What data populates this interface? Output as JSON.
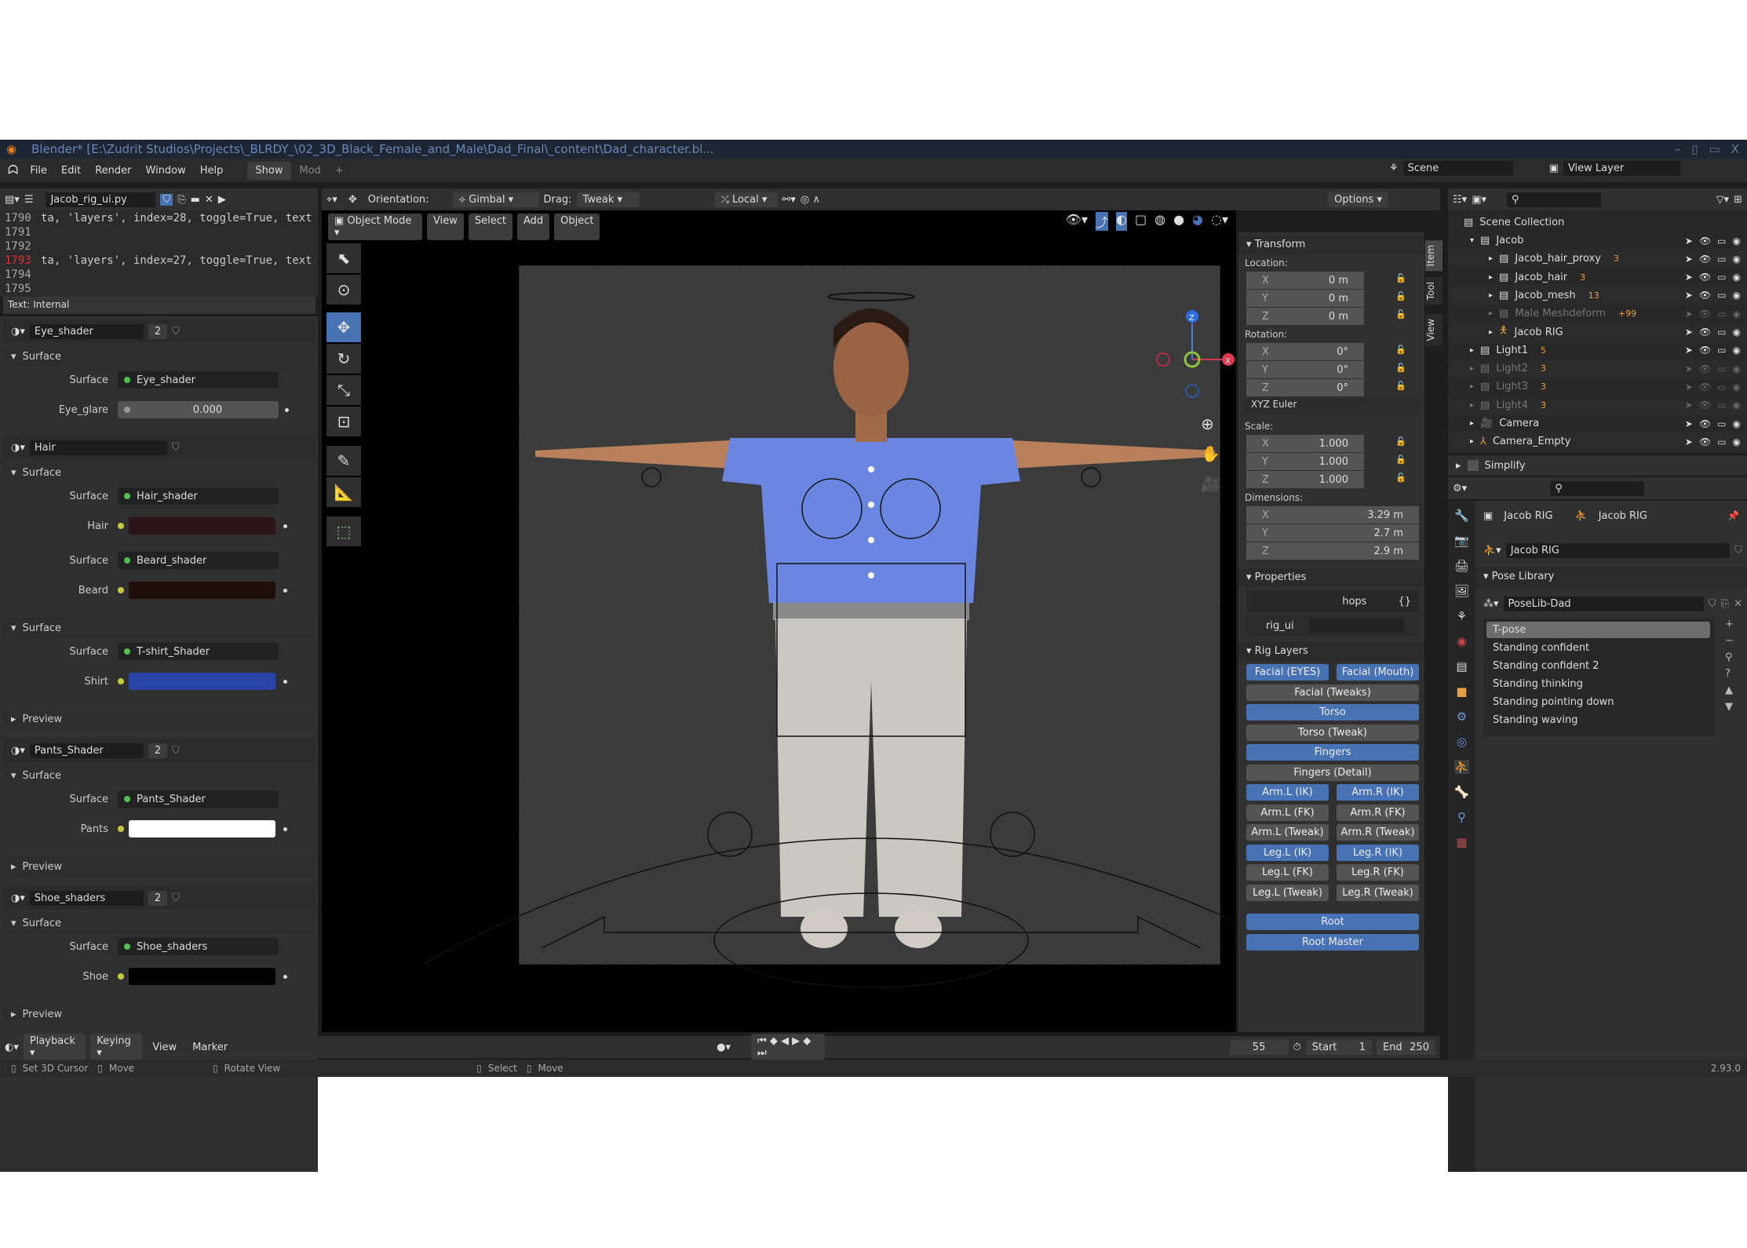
{
  "title_bar": {
    "text": "Blender* [E:\\Zudrit Studios\\Projects\\_BLRDY_\\02_3D_Black_Female_and_Male\\Dad_Final\\_content\\Dad_character.bl...",
    "controls": [
      "–",
      "▯",
      "▭",
      "X"
    ]
  },
  "menu": {
    "items": [
      "File",
      "Edit",
      "Render",
      "Window",
      "Help"
    ],
    "workspaces": [
      "Show",
      "Mod"
    ],
    "add": "+",
    "scene": "Scene",
    "view_layer": "View Layer"
  },
  "text_editor": {
    "filename": "Jacob_rig_ui.py",
    "lines": [
      {
        "n": "1790",
        "code": "ta, 'layers', index=28, toggle=True, text"
      },
      {
        "n": "1791",
        "code": ""
      },
      {
        "n": "1792",
        "code": ""
      },
      {
        "n": "1793",
        "code": "ta, 'layers', index=27, toggle=True, text"
      },
      {
        "n": "1794",
        "code": ""
      },
      {
        "n": "1795",
        "code": ""
      }
    ],
    "footer": "Text: Internal"
  },
  "materials": [
    {
      "name": "Eye_shader",
      "users": "2",
      "sections": [
        {
          "title": "Surface",
          "rows": [
            {
              "label": "Surface",
              "value": "Eye_shader",
              "type": "shader"
            },
            {
              "label": "Eye_glare",
              "value": "0.000",
              "type": "number"
            }
          ]
        }
      ]
    },
    {
      "name": "Hair",
      "users": "",
      "sections": [
        {
          "title": "Surface",
          "rows": [
            {
              "label": "Surface",
              "value": "Hair_shader",
              "type": "shader"
            },
            {
              "label": "Hair",
              "color": "#2a1618",
              "type": "color"
            },
            {
              "label": "Surface",
              "value": "Beard_shader",
              "type": "shader"
            },
            {
              "label": "Beard",
              "color": "#1e0f0a",
              "type": "color"
            }
          ]
        },
        {
          "title": "Surface",
          "rows": [
            {
              "label": "Surface",
              "value": "T-shirt_Shader",
              "type": "shader"
            },
            {
              "label": "Shirt",
              "color": "#2a45a8",
              "type": "color"
            }
          ]
        },
        {
          "title": "Preview",
          "rows": []
        }
      ]
    },
    {
      "name": "Pants_Shader",
      "users": "2",
      "sections": [
        {
          "title": "Surface",
          "rows": [
            {
              "label": "Surface",
              "value": "Pants_Shader",
              "type": "shader"
            },
            {
              "label": "Pants",
              "color": "#ffffff",
              "type": "color"
            }
          ]
        },
        {
          "title": "Preview",
          "rows": []
        }
      ]
    },
    {
      "name": "Shoe_shaders",
      "users": "2",
      "sections": [
        {
          "title": "Surface",
          "rows": [
            {
              "label": "Surface",
              "value": "Shoe_shaders",
              "type": "shader"
            },
            {
              "label": "Shoe",
              "color": "#000000",
              "type": "color"
            }
          ]
        },
        {
          "title": "Preview",
          "rows": []
        }
      ]
    }
  ],
  "viewport": {
    "orientation_label": "Orientation:",
    "orientation": "Gimbal",
    "drag_label": "Drag:",
    "drag": "Tweak",
    "pivot": "Local",
    "options": "Options",
    "mode": "Object Mode",
    "menus": [
      "View",
      "Select",
      "Add",
      "Object"
    ],
    "gizmo": {
      "z": "Z",
      "x": "X"
    }
  },
  "n_panel": {
    "tabs": [
      "Item",
      "Tool",
      "View"
    ],
    "transform": {
      "title": "Transform",
      "location_label": "Location:",
      "location": [
        {
          "axis": "X",
          "value": "0 m"
        },
        {
          "axis": "Y",
          "value": "0 m"
        },
        {
          "axis": "Z",
          "value": "0 m"
        }
      ],
      "rotation_label": "Rotation:",
      "rotation": [
        {
          "axis": "X",
          "value": "0°"
        },
        {
          "axis": "Y",
          "value": "0°"
        },
        {
          "axis": "Z",
          "value": "0°"
        }
      ],
      "rotation_mode": "XYZ Euler",
      "scale_label": "Scale:",
      "scale": [
        {
          "axis": "X",
          "value": "1.000"
        },
        {
          "axis": "Y",
          "value": "1.000"
        },
        {
          "axis": "Z",
          "value": "1.000"
        }
      ],
      "dimensions_label": "Dimensions:",
      "dimensions": [
        {
          "axis": "X",
          "value": "3.29 m"
        },
        {
          "axis": "Y",
          "value": "2.7 m"
        },
        {
          "axis": "Z",
          "value": "2.9 m"
        }
      ]
    },
    "properties": {
      "title": "Properties",
      "hops": "hops",
      "hops_icon": "{}",
      "rig_ui": "rig_ui"
    },
    "rig_layers": {
      "title": "Rig Layers",
      "buttons": [
        [
          {
            "label": "Facial (EYES)",
            "on": true
          },
          {
            "label": "Facial (Mouth)",
            "on": true
          }
        ],
        [
          {
            "label": "Facial (Tweaks)",
            "on": false
          }
        ],
        [
          {
            "label": "Torso",
            "on": true
          }
        ],
        [
          {
            "label": "Torso (Tweak)",
            "on": false
          }
        ],
        [
          {
            "label": "Fingers",
            "on": true
          }
        ],
        [
          {
            "label": "Fingers (Detail)",
            "on": false
          }
        ],
        [
          {
            "label": "Arm.L (IK)",
            "on": true
          },
          {
            "label": "Arm.R (IK)",
            "on": true
          }
        ],
        [
          {
            "label": "Arm.L (FK)",
            "on": false
          },
          {
            "label": "Arm.R (FK)",
            "on": false
          }
        ],
        [
          {
            "label": "Arm.L (Tweak)",
            "on": false
          },
          {
            "label": "Arm.R (Tweak)",
            "on": false
          }
        ],
        [
          {
            "label": "Leg.L (IK)",
            "on": true
          },
          {
            "label": "Leg.R (IK)",
            "on": true
          }
        ],
        [
          {
            "label": "Leg.L (FK)",
            "on": false
          },
          {
            "label": "Leg.R (FK)",
            "on": false
          }
        ],
        [
          {
            "label": "Leg.L (Tweak)",
            "on": false
          },
          {
            "label": "Leg.R (Tweak)",
            "on": false
          }
        ],
        [
          {
            "label": "Root",
            "on": true
          }
        ],
        [
          {
            "label": "Root Master",
            "on": true
          }
        ]
      ]
    }
  },
  "outliner": {
    "root": "Scene Collection",
    "rows": [
      {
        "name": "Jacob",
        "depth": 0,
        "expanded": true,
        "dim": false
      },
      {
        "name": "Jacob_hair_proxy",
        "depth": 1,
        "dim": false,
        "badge": "3"
      },
      {
        "name": "Jacob_hair",
        "depth": 1,
        "dim": false,
        "badge": "3"
      },
      {
        "name": "Jacob_mesh",
        "depth": 1,
        "dim": false,
        "badge": "13"
      },
      {
        "name": "Male Meshdeform",
        "depth": 1,
        "dim": true,
        "badge": "+99"
      },
      {
        "name": "Jacob RIG",
        "depth": 1,
        "dim": false,
        "badge": ""
      },
      {
        "name": "Light1",
        "depth": 0,
        "dim": false,
        "badge": "5"
      },
      {
        "name": "Light2",
        "depth": 0,
        "dim": true,
        "badge": "3"
      },
      {
        "name": "Light3",
        "depth": 0,
        "dim": true,
        "badge": "3"
      },
      {
        "name": "Light4",
        "depth": 0,
        "dim": true,
        "badge": "3"
      },
      {
        "name": "Camera",
        "depth": 0,
        "dim": false,
        "badge": ""
      },
      {
        "name": "Camera_Empty",
        "depth": 0,
        "dim": false,
        "badge": ""
      }
    ],
    "simplify": "Simplify"
  },
  "properties_editor": {
    "breadcrumb": [
      "Jacob RIG",
      "Jacob RIG"
    ],
    "data_name": "Jacob RIG",
    "pose_library": "Pose Library",
    "poselib": "PoseLib-Dad",
    "poses": [
      "T-pose",
      "Standing confident",
      "Standing confident 2",
      "Standing thinking",
      "Standing pointing down",
      "Standing waving"
    ],
    "active_pose": 0
  },
  "timeline": {
    "menus": [
      "Playback",
      "Keying",
      "View",
      "Marker"
    ],
    "current_frame": "55",
    "start_label": "Start",
    "start": "1",
    "end_label": "End",
    "end": "250"
  },
  "status_bar": {
    "items": [
      "Set 3D Cursor",
      "Move",
      "Rotate View",
      "Select",
      "Move"
    ],
    "version": "2.93.0"
  },
  "colors": {
    "accent": "#4772b3",
    "shirt": "#6b86e0",
    "pants": "#c9c9c1"
  }
}
